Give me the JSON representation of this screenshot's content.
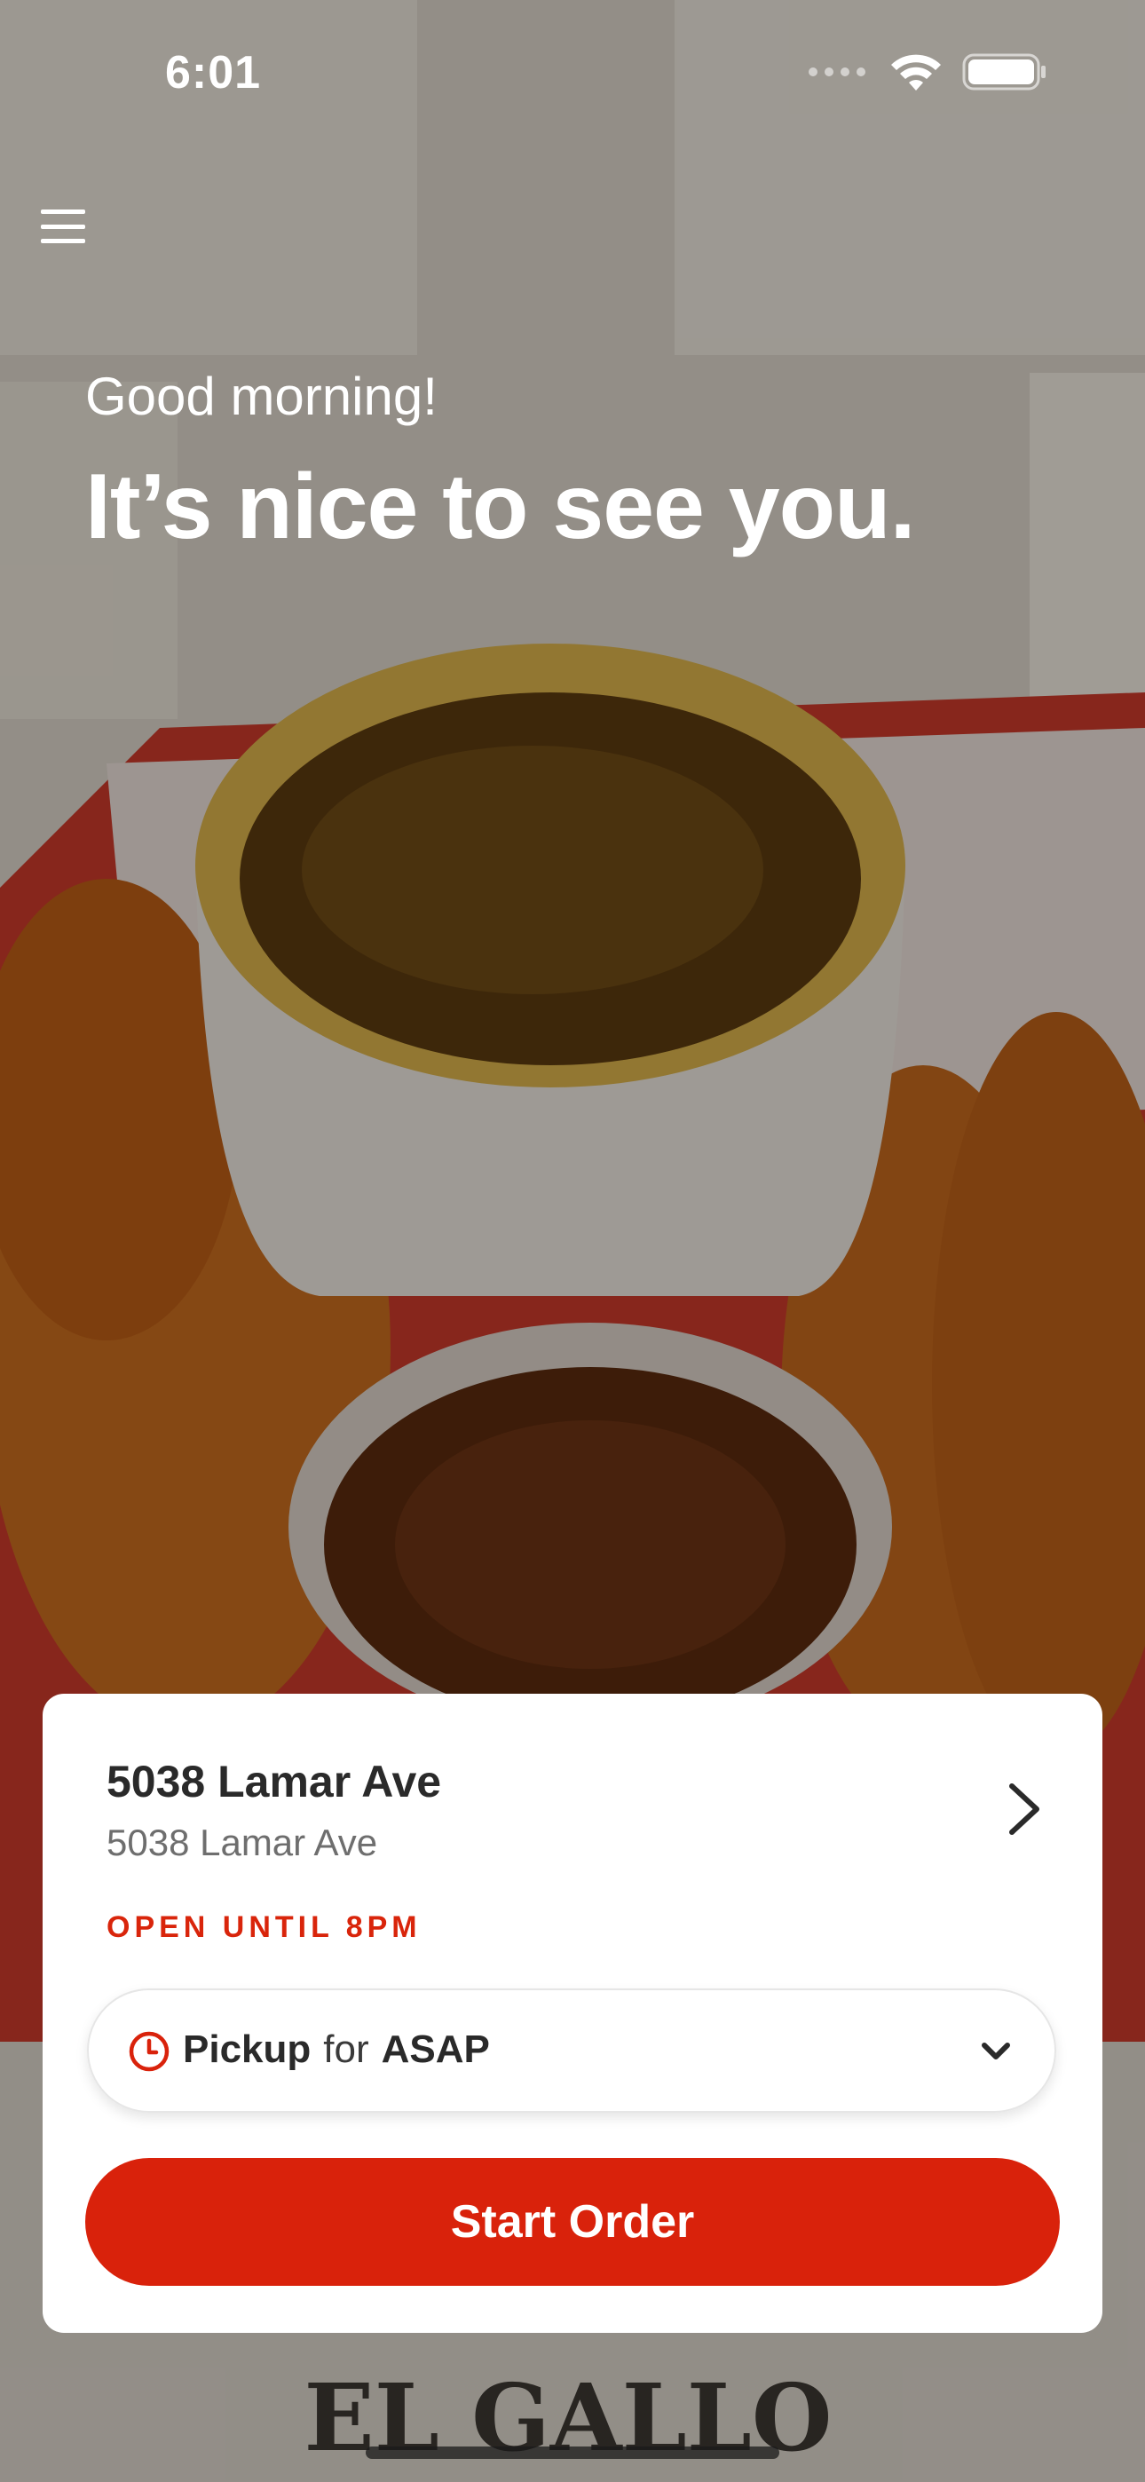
{
  "status_bar": {
    "time": "6:01"
  },
  "icons": {
    "menu": "hamburger-menu-icon",
    "signal": "cellular-signal-icon",
    "wifi": "wifi-icon",
    "battery": "battery-icon",
    "chevron_right": "chevron-right-icon",
    "clock": "clock-icon",
    "chevron_down": "chevron-down-icon"
  },
  "hero": {
    "greeting": "Good morning!",
    "headline": "It’s nice to see you.",
    "background_logo_text": "EL GALLO"
  },
  "location_card": {
    "title": "5038 Lamar Ave",
    "address": "5038 Lamar Ave",
    "open_status": "OPEN UNTIL 8PM",
    "order_mode": {
      "mode": "Pickup",
      "connector": "for",
      "time": "ASAP"
    },
    "start_button_label": "Start Order"
  },
  "colors": {
    "accent_red": "#d9220b",
    "card_bg": "#ffffff",
    "text_dark": "#2a2a2a",
    "text_muted": "#6e6e6e"
  }
}
